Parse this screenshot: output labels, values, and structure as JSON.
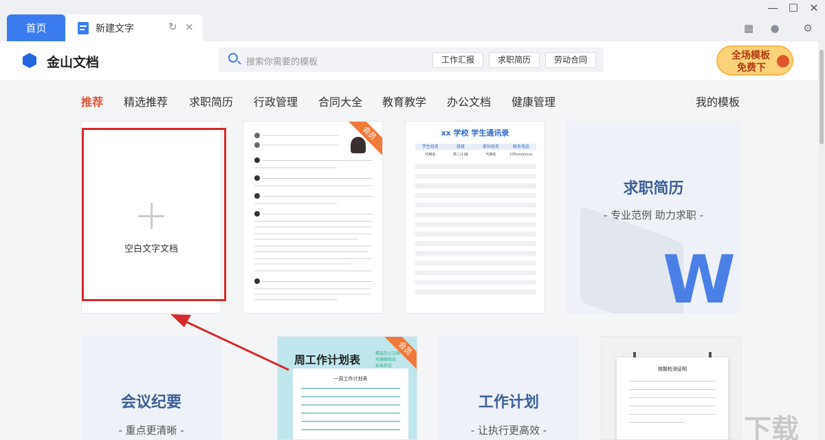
{
  "tabs": {
    "home": "首页",
    "doc": "新建文字",
    "refresh_icon": "↻",
    "close_icon": "×"
  },
  "window": {
    "minimize": "—",
    "maximize": "☐",
    "close": "✕"
  },
  "tools": {
    "apps_icon": "▦",
    "message_icon": "●",
    "settings_icon": "⚙"
  },
  "header": {
    "logo": "金山文档",
    "search_placeholder": "搜索你需要的模板",
    "chips": [
      "工作汇报",
      "求职简历",
      "劳动合同"
    ],
    "promo_line1": "全场模板",
    "promo_line2": "免费下"
  },
  "nav": {
    "items": [
      "推荐",
      "精选推荐",
      "求职简历",
      "行政管理",
      "合同大全",
      "教育教学",
      "办公文档",
      "健康管理"
    ],
    "my_templates": "我的模板"
  },
  "cards": {
    "blank": "空白文字文档",
    "member_badge": "会员",
    "roster_title": "xx 学校  学生通讯录",
    "roster_headers": [
      "学生姓名",
      "班级",
      "家长姓名",
      "联系电话"
    ],
    "roster_row": [
      "代用名",
      "高二(1)班",
      "代用名",
      "135xxxxxxxx"
    ],
    "resume_title": "求职简历",
    "resume_sub": "- 专业范例  助力求职 -",
    "meeting_title": "会议纪要",
    "meeting_sub": "- 重点更清晰 -",
    "weekly_title": "周工作计划表",
    "weekly_side": [
      "精选办公文档",
      "可编辑修改",
      "标准样式"
    ],
    "weekly_paper_title": "一周工作计划表",
    "plan_title": "工作计划",
    "plan_sub": "- 让执行更高效 -",
    "cert_title": "核酸检测证明"
  },
  "watermark": "下载"
}
